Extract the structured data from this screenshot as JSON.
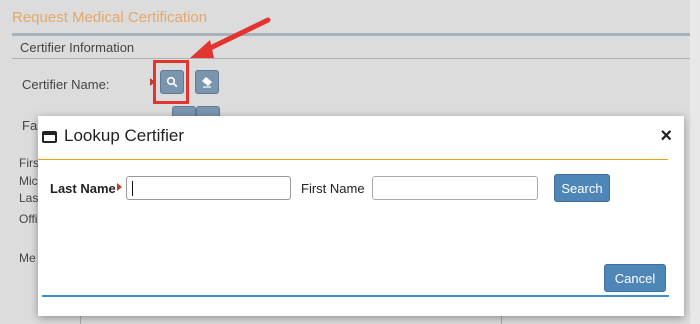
{
  "background": {
    "page_title": "Request Medical Certification",
    "section_title": "Certifier Information",
    "certifier_name_label": "Certifier Name:",
    "partial_labels": [
      "Fa",
      "Firs",
      "Mic",
      "Las",
      "Offi",
      "Me"
    ],
    "search_icon": "search-icon",
    "eraser_icon": "eraser-icon"
  },
  "modal": {
    "title": "Lookup Certifier",
    "close_label": "×",
    "last_name_label": "Last Name",
    "last_name_value": "",
    "first_name_label": "First Name",
    "first_name_value": "",
    "search_button": "Search",
    "cancel_button": "Cancel"
  },
  "colors": {
    "accent_orange": "#f0a400",
    "button_blue": "#4f86b8",
    "highlight_red": "#e3342f",
    "title_orange": "#e4a86a"
  }
}
